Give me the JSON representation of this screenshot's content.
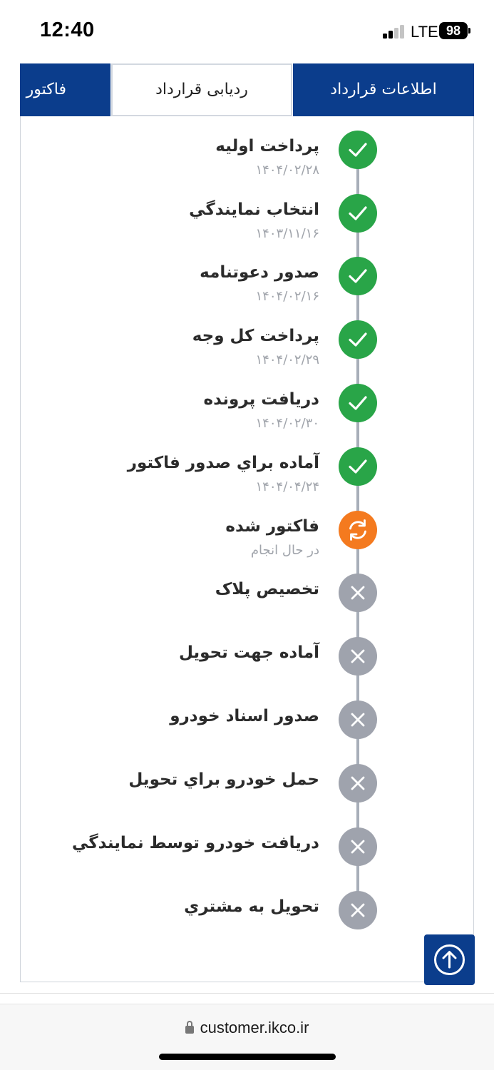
{
  "status_bar": {
    "time": "12:40",
    "network": "LTE",
    "battery": "98",
    "signal_bars_lit": 2,
    "signal_bars_total": 4
  },
  "tabs": [
    {
      "label": "اطلاعات قرارداد",
      "state": "active"
    },
    {
      "label": "ردیابی قرارداد",
      "state": "selected"
    },
    {
      "label": "فاکتور",
      "state": "active"
    }
  ],
  "timeline": {
    "steps": [
      {
        "title": "پرداخت اولیه",
        "subtitle": "۱۴۰۴/۰۲/۲۸",
        "status": "done",
        "icon": "check-icon"
      },
      {
        "title": "انتخاب نمایندگي",
        "subtitle": "۱۴۰۳/۱۱/۱۶",
        "status": "done",
        "icon": "check-icon"
      },
      {
        "title": "صدور دعوتنامه",
        "subtitle": "۱۴۰۴/۰۲/۱۶",
        "status": "done",
        "icon": "check-icon"
      },
      {
        "title": "پرداخت کل وجه",
        "subtitle": "۱۴۰۴/۰۲/۲۹",
        "status": "done",
        "icon": "check-icon"
      },
      {
        "title": "دریافت پرونده",
        "subtitle": "۱۴۰۴/۰۲/۳۰",
        "status": "done",
        "icon": "check-icon"
      },
      {
        "title": "آماده براي صدور فاکتور",
        "subtitle": "۱۴۰۴/۰۴/۲۴",
        "status": "done",
        "icon": "check-icon"
      },
      {
        "title": "فاکتور شده",
        "subtitle": "در حال انجام",
        "status": "in-progress",
        "icon": "refresh-icon"
      },
      {
        "title": "تخصیص پلاک",
        "subtitle": "",
        "status": "pending",
        "icon": "x-icon"
      },
      {
        "title": "آماده جهت تحویل",
        "subtitle": "",
        "status": "pending",
        "icon": "x-icon"
      },
      {
        "title": "صدور اسناد خودرو",
        "subtitle": "",
        "status": "pending",
        "icon": "x-icon"
      },
      {
        "title": "حمل خودرو براي تحویل",
        "subtitle": "",
        "status": "pending",
        "icon": "x-icon"
      },
      {
        "title": "دریافت خودرو توسط نمایندگي",
        "subtitle": "",
        "status": "pending",
        "icon": "x-icon"
      },
      {
        "title": "تحویل به مشتري",
        "subtitle": "",
        "status": "pending",
        "icon": "x-icon"
      }
    ]
  },
  "scroll_top": {
    "icon": "arrow-up-circle-icon"
  },
  "browser": {
    "url": "customer.ikco.ir",
    "lock_icon": "lock-icon"
  },
  "colors": {
    "primary": "#0b3d8c",
    "done": "#29a548",
    "in_progress": "#f47a1f",
    "pending": "#9fa3ad",
    "connector": "#a7aeb9"
  }
}
